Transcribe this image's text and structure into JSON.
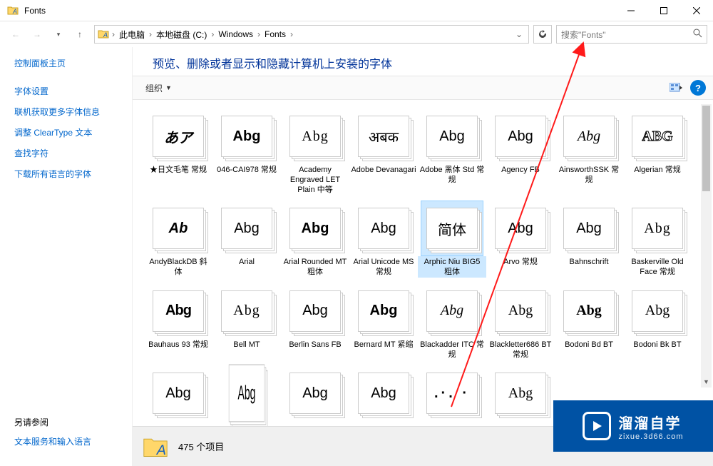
{
  "window": {
    "title": "Fonts"
  },
  "nav": {
    "breadcrumb": [
      "此电脑",
      "本地磁盘 (C:)",
      "Windows",
      "Fonts"
    ]
  },
  "search": {
    "placeholder": "搜索\"Fonts\""
  },
  "sidebar": {
    "home": "控制面板主页",
    "links": [
      "字体设置",
      "联机获取更多字体信息",
      "调整 ClearType 文本",
      "查找字符",
      "下载所有语言的字体"
    ],
    "see_also_head": "另请参阅",
    "see_also": [
      "文本服务和输入语言"
    ]
  },
  "header": {
    "title": "预览、删除或者显示和隐藏计算机上安装的字体"
  },
  "toolbar": {
    "organize": "组织"
  },
  "fonts": [
    {
      "preview": "あア",
      "cls": "fs-brush",
      "label": "★日文毛笔 常规"
    },
    {
      "preview": "Abg",
      "cls": "fs-bold",
      "label": "046-CAI978 常规"
    },
    {
      "preview": "Abg",
      "cls": "fs-serif-out",
      "label": "Academy Engraved LET Plain 中等"
    },
    {
      "preview": "अबक",
      "cls": "fs-dev",
      "label": "Adobe Devanagari"
    },
    {
      "preview": "Abg",
      "cls": "fs-plain",
      "label": "Adobe 黑体 Std 常规"
    },
    {
      "preview": "Abg",
      "cls": "fs-cond",
      "label": "Agency FB"
    },
    {
      "preview": "Abg",
      "cls": "fs-old",
      "label": "AinsworthSSK 常规"
    },
    {
      "preview": "ABG",
      "cls": "fs-outline",
      "label": "Algerian 常规"
    },
    {
      "preview": "Ab",
      "cls": "fs-italicb",
      "label": "AndyBlackDB 斜体"
    },
    {
      "preview": "Abg",
      "cls": "fs-plain",
      "label": "Arial"
    },
    {
      "preview": "Abg",
      "cls": "fs-bold",
      "label": "Arial Rounded MT 粗体"
    },
    {
      "preview": "Abg",
      "cls": "fs-plain",
      "label": "Arial Unicode MS 常规"
    },
    {
      "preview": "简体",
      "cls": "fs-plain",
      "label": "Arphic Niu BIG5 粗体",
      "selected": true
    },
    {
      "preview": "Abg",
      "cls": "fs-plain",
      "label": "Arvo 常规"
    },
    {
      "preview": "Abg",
      "cls": "fs-plain",
      "label": "Bahnschrift"
    },
    {
      "preview": "Abg",
      "cls": "fs-serif-out",
      "label": "Baskerville Old Face 常规"
    },
    {
      "preview": "Abg",
      "cls": "fs-sq",
      "label": "Bauhaus 93 常规"
    },
    {
      "preview": "Abg",
      "cls": "fs-serif-out",
      "label": "Bell MT"
    },
    {
      "preview": "Abg",
      "cls": "fs-plain",
      "label": "Berlin Sans FB"
    },
    {
      "preview": "Abg",
      "cls": "fs-bold",
      "label": "Bernard MT 紧缩"
    },
    {
      "preview": "Abg",
      "cls": "fs-script",
      "label": "Blackadder ITC 常规"
    },
    {
      "preview": "Abg",
      "cls": "fs-goth",
      "label": "Blackletter686 BT 常规"
    },
    {
      "preview": "Abg",
      "cls": "fs-bodoni",
      "label": "Bodoni Bd BT"
    },
    {
      "preview": "Abg",
      "cls": "fs-bodonil",
      "label": "Bodoni Bk BT"
    },
    {
      "preview": "Abg",
      "cls": "fs-plain",
      "label": ""
    },
    {
      "preview": "Abg",
      "cls": "fs-tall",
      "label": ""
    },
    {
      "preview": "Abg",
      "cls": "fs-plain",
      "label": ""
    },
    {
      "preview": "Abg",
      "cls": "fs-plain",
      "label": ""
    },
    {
      "preview": ".·. ·",
      "cls": "fs-dots",
      "label": ""
    },
    {
      "preview": "Abg",
      "cls": "fs-hand",
      "label": ""
    }
  ],
  "status": {
    "count": "475 个项目"
  },
  "watermark": {
    "line1": "溜溜自学",
    "line2": "zixue.3d66.com"
  }
}
